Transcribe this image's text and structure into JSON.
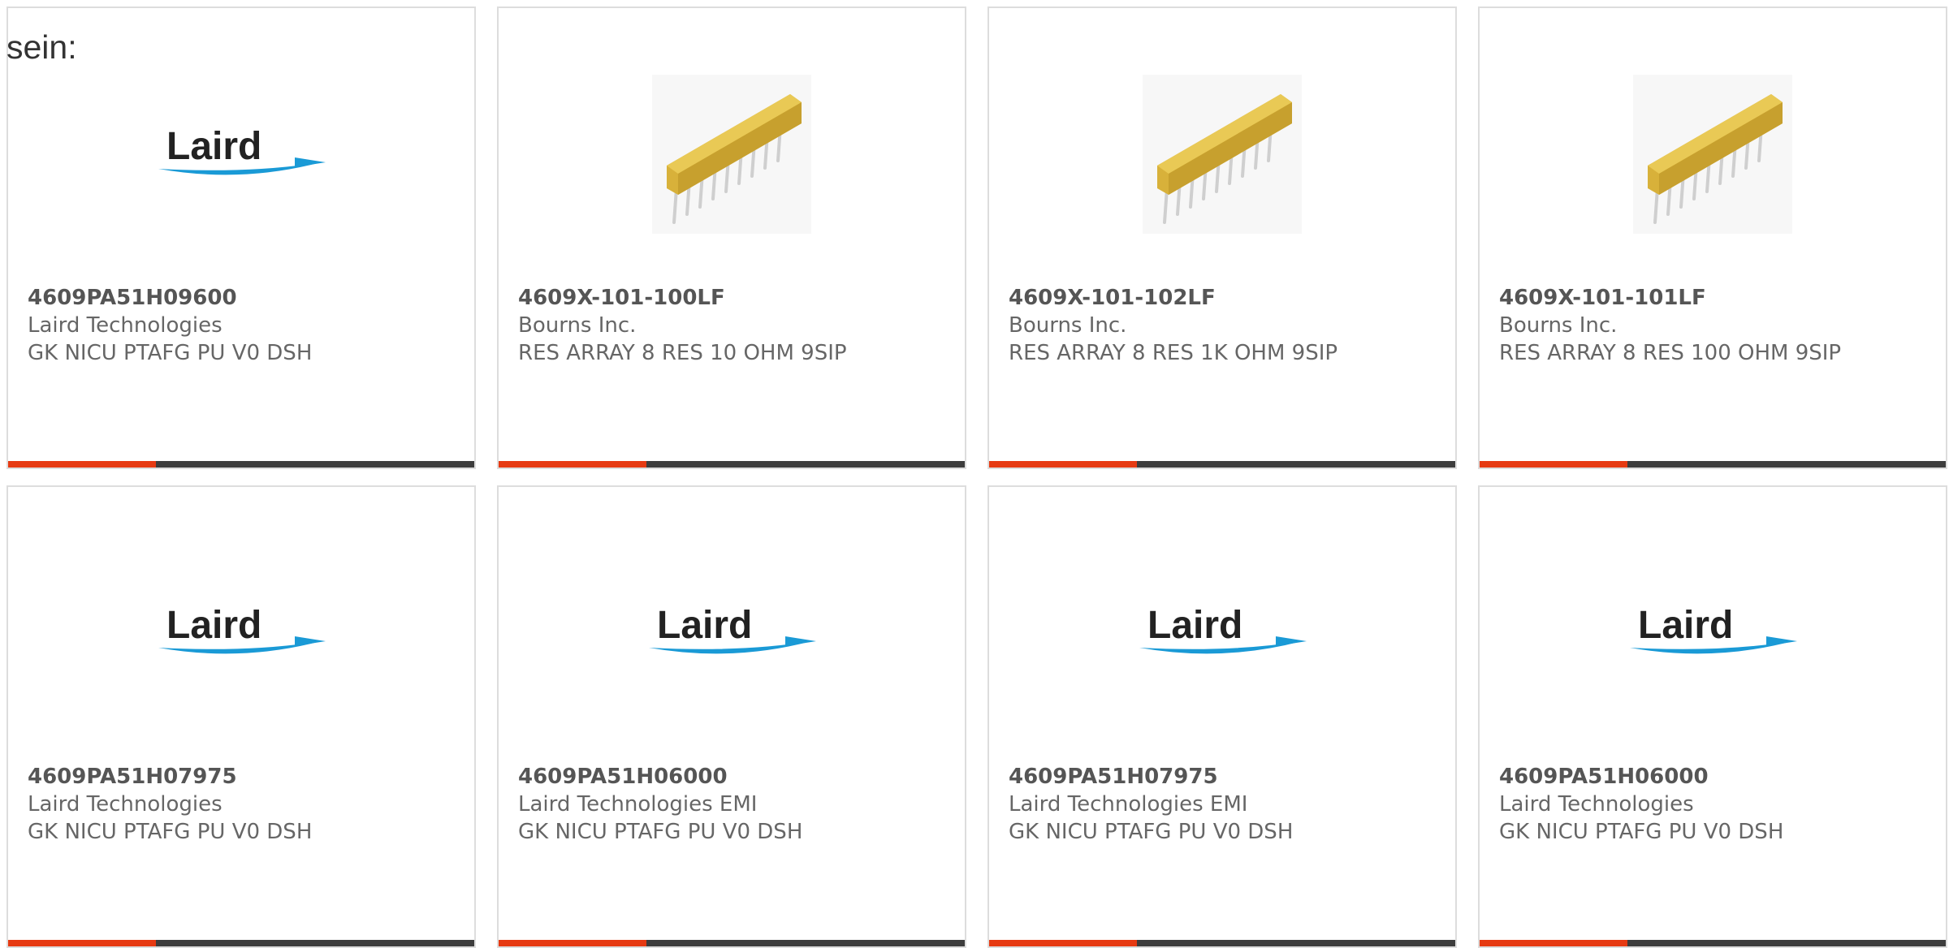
{
  "intro_text": "sein:",
  "colors": {
    "accent": "#e63a12",
    "bar": "#3d3d3d",
    "border": "#dddddd",
    "laird_blue": "#1a9ad6"
  },
  "products": [
    {
      "part_number": "4609PA51H09600",
      "manufacturer": "Laird Technologies",
      "description": "GK NICU PTAFG PU V0 DSH",
      "image": "laird-logo",
      "logo_text": "Laird"
    },
    {
      "part_number": "4609X-101-100LF",
      "manufacturer": "Bourns Inc.",
      "description": "RES ARRAY 8 RES 10 OHM 9SIP",
      "image": "resistor-array-photo"
    },
    {
      "part_number": "4609X-101-102LF",
      "manufacturer": "Bourns Inc.",
      "description": "RES ARRAY 8 RES 1K OHM 9SIP",
      "image": "resistor-array-photo"
    },
    {
      "part_number": "4609X-101-101LF",
      "manufacturer": "Bourns Inc.",
      "description": "RES ARRAY 8 RES 100 OHM 9SIP",
      "image": "resistor-array-photo"
    },
    {
      "part_number": "4609PA51H07975",
      "manufacturer": "Laird Technologies",
      "description": "GK NICU PTAFG PU V0 DSH",
      "image": "laird-logo",
      "logo_text": "Laird"
    },
    {
      "part_number": "4609PA51H06000",
      "manufacturer": "Laird Technologies EMI",
      "description": "GK NICU PTAFG PU V0 DSH",
      "image": "laird-logo",
      "logo_text": "Laird"
    },
    {
      "part_number": "4609PA51H07975",
      "manufacturer": "Laird Technologies EMI",
      "description": "GK NICU PTAFG PU V0 DSH",
      "image": "laird-logo",
      "logo_text": "Laird"
    },
    {
      "part_number": "4609PA51H06000",
      "manufacturer": "Laird Technologies",
      "description": "GK NICU PTAFG PU V0 DSH",
      "image": "laird-logo",
      "logo_text": "Laird"
    }
  ]
}
